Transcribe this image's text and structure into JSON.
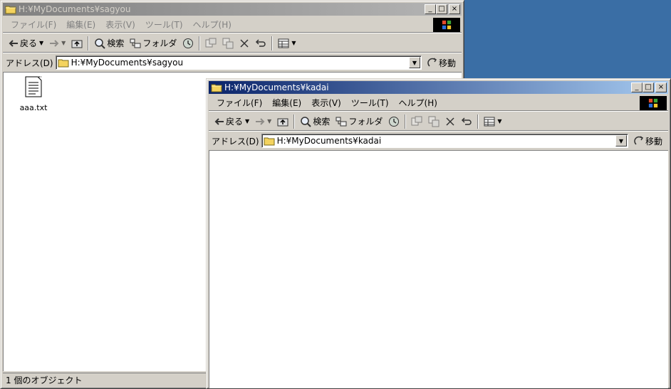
{
  "desktop": {
    "background": "#3a6ea5"
  },
  "window_back": {
    "title": "H:¥MyDocuments¥sagyou",
    "state": "inactive",
    "menu": [
      "ファイル(F)",
      "編集(E)",
      "表示(V)",
      "ツール(T)",
      "ヘルプ(H)"
    ],
    "toolbar": {
      "back": "戻る",
      "search": "検索",
      "folders": "フォルダ"
    },
    "address": {
      "label": "アドレス(D)",
      "value": "H:¥MyDocuments¥sagyou",
      "go": "移動"
    },
    "files": [
      {
        "name": "aaa.txt",
        "icon": "text-file-icon"
      }
    ],
    "status": "1 個のオブジェクト"
  },
  "window_front": {
    "title": "H:¥MyDocuments¥kadai",
    "state": "active",
    "menu": [
      "ファイル(F)",
      "編集(E)",
      "表示(V)",
      "ツール(T)",
      "ヘルプ(H)"
    ],
    "toolbar": {
      "back": "戻る",
      "search": "検索",
      "folders": "フォルダ"
    },
    "address": {
      "label": "アドレス(D)",
      "value": "H:¥MyDocuments¥kadai",
      "go": "移動"
    },
    "files": []
  },
  "caption_buttons": {
    "minimize": "_",
    "maximize": "□",
    "close": "×"
  },
  "colors": {
    "active_title": "#0a246a",
    "inactive_title": "#808080",
    "face": "#d4d0c8"
  }
}
